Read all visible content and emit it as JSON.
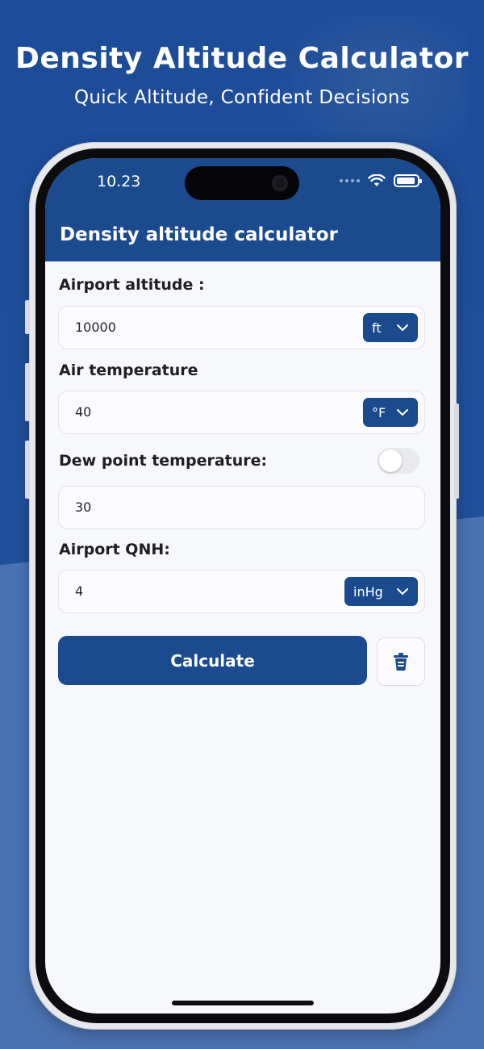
{
  "promo": {
    "title": "Density Altitude Calculator",
    "subtitle": "Quick Altitude, Confident Decisions"
  },
  "status_bar": {
    "time": "10.23",
    "icons": [
      "signal-dots-icon",
      "wifi-icon",
      "battery-icon"
    ]
  },
  "app_bar": {
    "title": "Density altitude calculator"
  },
  "form": {
    "airport_altitude": {
      "label": "Airport altitude :",
      "value": "10000",
      "unit": "ft"
    },
    "air_temperature": {
      "label": "Air temperature",
      "value": "40",
      "unit": "°F"
    },
    "dew_point": {
      "label": "Dew point temperature:",
      "value": "30",
      "toggle_on": false
    },
    "airport_qnh": {
      "label": "Airport QNH:",
      "value": "4",
      "unit": "inHg"
    }
  },
  "actions": {
    "calculate_label": "Calculate",
    "clear_icon": "trash-icon"
  },
  "colors": {
    "brand": "#1c4a8f",
    "background": "#1f4e99",
    "screen": "#f7f8fc"
  }
}
